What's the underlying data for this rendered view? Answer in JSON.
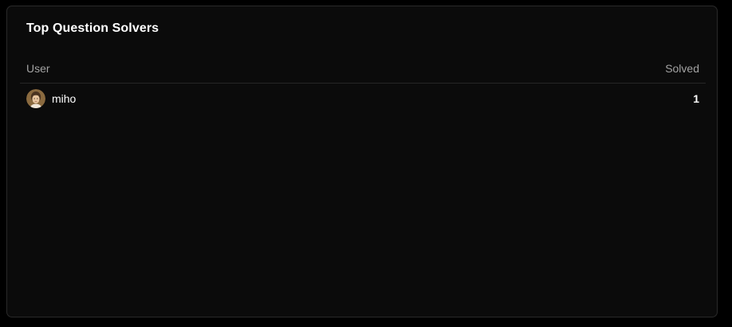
{
  "leaderboard": {
    "title": "Top Question Solvers",
    "columns": {
      "user": "User",
      "solved": "Solved"
    },
    "rows": [
      {
        "username": "miho",
        "solved": "1",
        "avatar_icon": "user-avatar-icon"
      }
    ]
  },
  "colors": {
    "background": "#000000",
    "card": "#0b0b0b",
    "border": "#2a2a2a",
    "text_primary": "#ffffff",
    "text_muted": "#a3a3a3"
  }
}
